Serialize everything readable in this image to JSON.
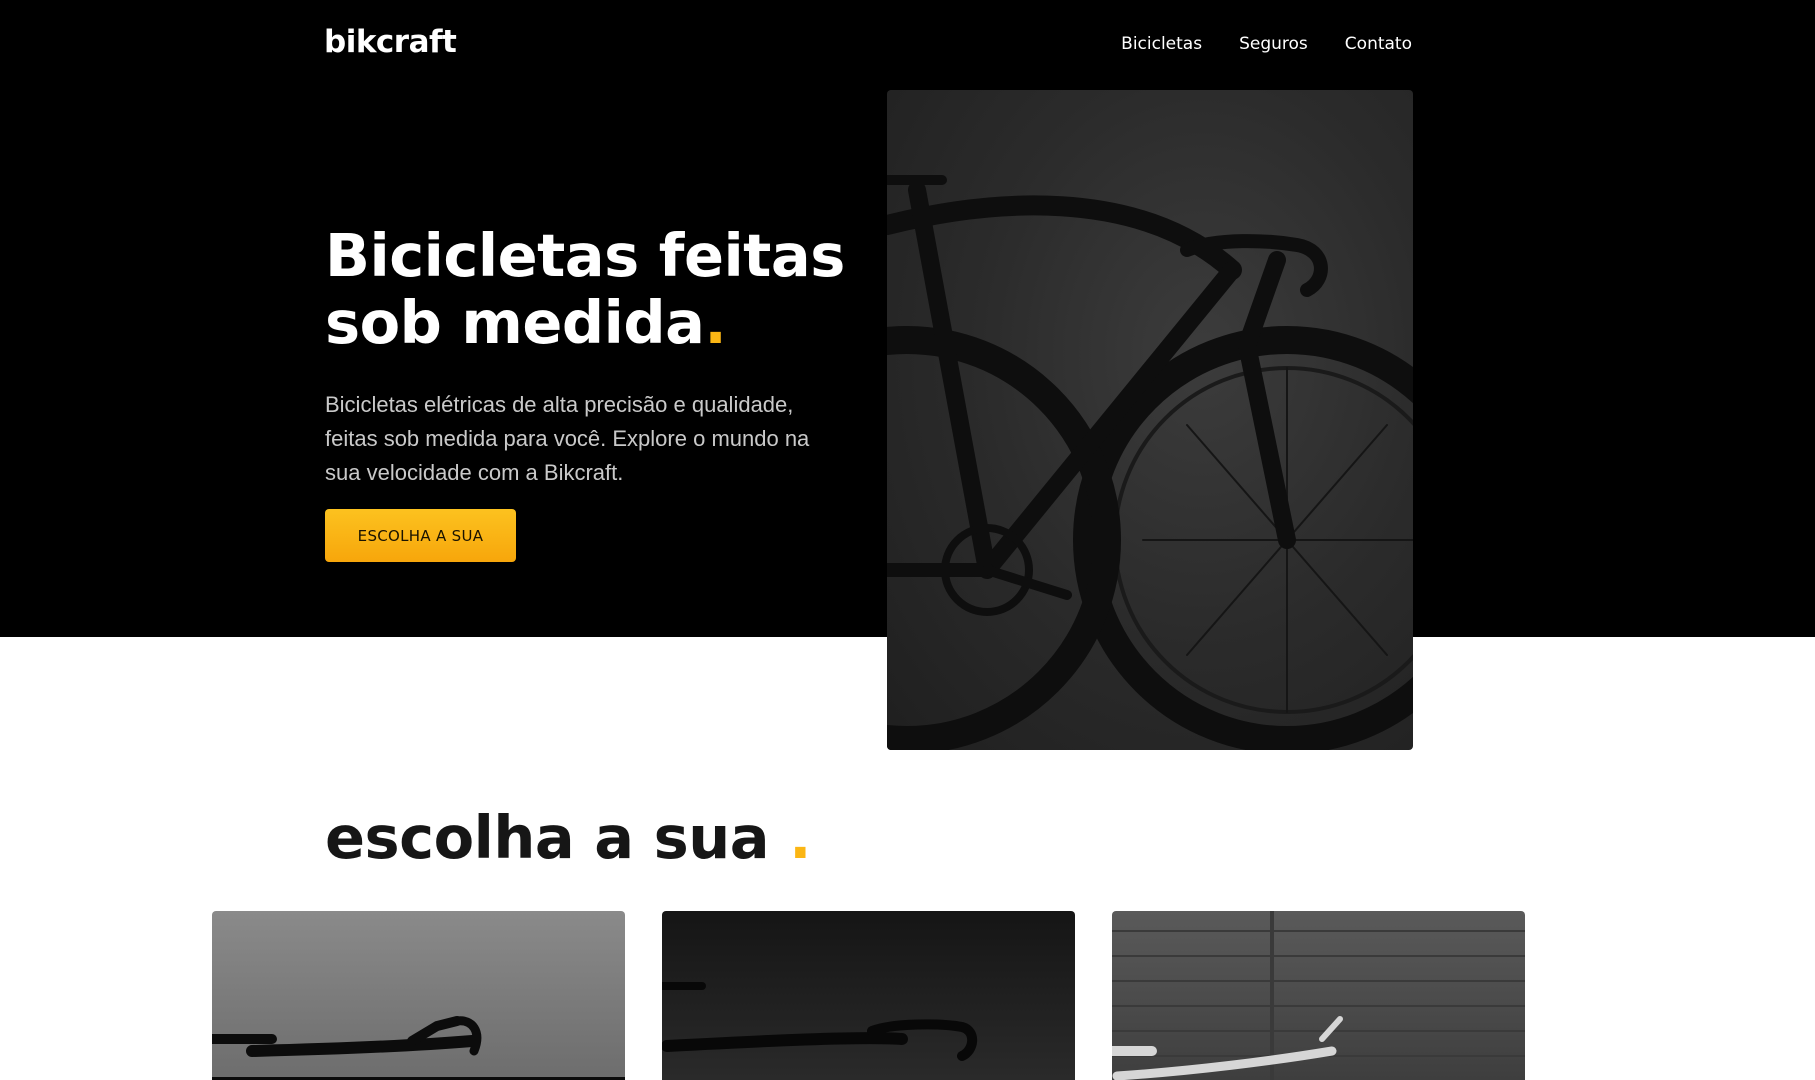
{
  "brand": {
    "logo": "bikcraft"
  },
  "nav": {
    "items": [
      "Bicicletas",
      "Seguros",
      "Contato"
    ]
  },
  "hero": {
    "title": "Bicicletas feitas sob medida",
    "title_dot": ".",
    "text": "Bicicletas elétricas de alta precisão e qualidade, feitas sob medida para você. Explore o mundo na sua velocidade com a Bikcraft.",
    "cta_label": "ESCOLHA A SUA"
  },
  "section": {
    "title": "escolha a sua",
    "title_dot": "."
  },
  "colors": {
    "accent": "#fbb614",
    "dark": "#000000",
    "text_light": "#ffffff"
  }
}
